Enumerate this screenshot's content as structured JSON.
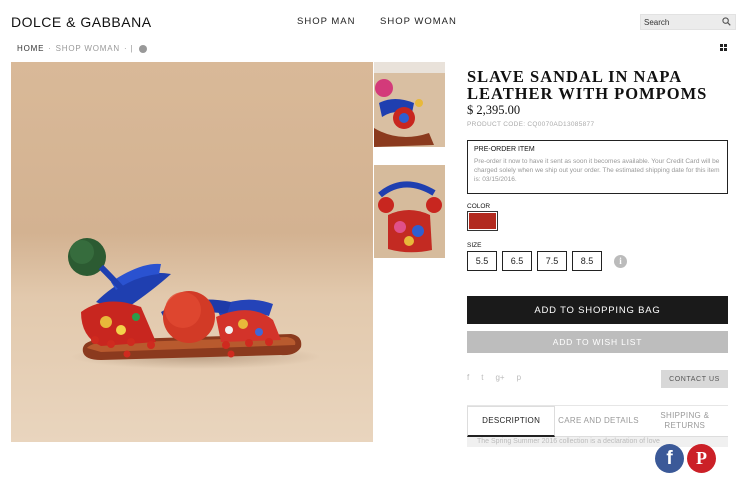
{
  "header": {
    "logo": "DOLCE & GABBANA",
    "nav": [
      "SHOP MAN",
      "SHOP WOMAN"
    ],
    "search_placeholder": "Search"
  },
  "breadcrumb": {
    "home": "HOME",
    "sep1": "·",
    "section": "SHOP WOMAN",
    "sep2": "· |"
  },
  "product": {
    "title": "SLAVE SANDAL IN NAPA LEATHER WITH POMPOMS",
    "price": "$ 2,395.00",
    "code": "PRODUCT CODE: CQ0070AD13085877",
    "preorder_heading": "PRE-ORDER ITEM",
    "preorder_body": "Pre-order it now to have it sent as soon it becomes available. Your Credit Card will be charged solely when we ship out your order. The estimated shipping date for this item is: 03/15/2016.",
    "color_label": "COLOR",
    "color_swatch": "#b22a1f",
    "size_label": "SIZE",
    "sizes": [
      "5.5",
      "6.5",
      "7.5",
      "8.5"
    ],
    "info_icon": "i"
  },
  "actions": {
    "add_to_bag": "ADD TO SHOPPING BAG",
    "add_to_wishlist": "ADD TO WISH LIST",
    "contact_us": "CONTACT US",
    "social": [
      "f",
      "t",
      "g+",
      "p"
    ]
  },
  "tabs": {
    "items": [
      "DESCRIPTION",
      "CARE AND DETAILS",
      "SHIPPING & RETURNS"
    ],
    "active": "DESCRIPTION",
    "content_preview": "The Spring Summer 2016 collection is a declaration of love"
  },
  "share": {
    "facebook": "f",
    "pinterest": "P"
  },
  "colors": {
    "primary_button": "#1a1a1a",
    "secondary_button": "#bdbdbd",
    "facebook": "#3b5998",
    "pinterest": "#cb2027"
  }
}
